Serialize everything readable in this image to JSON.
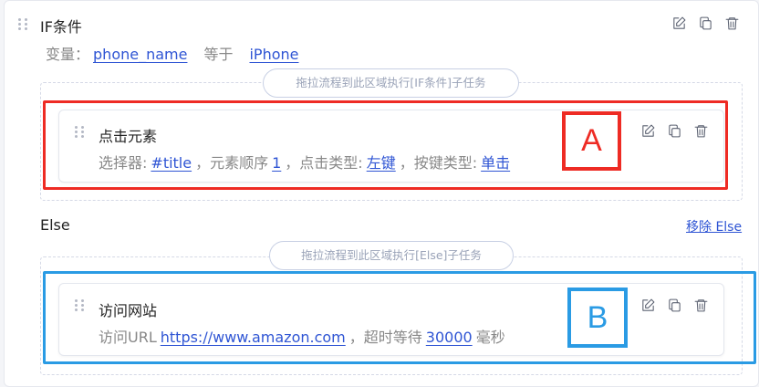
{
  "if_block": {
    "title": "IF条件",
    "condition": {
      "var_label": "变量：",
      "var_value": "phone_name",
      "operator": "等于",
      "compare_value": "iPhone"
    },
    "drop_hint": "拖拉流程到此区域执行[IF条件]子任务",
    "child": {
      "title": "点击元素",
      "selector_label": "选择器:",
      "selector_value": "#title",
      "order_label": "，元素顺序",
      "order_value": "1",
      "click_type_label": "，点击类型:",
      "click_type_value": "左键",
      "key_type_label": "，按键类型:",
      "key_type_value": "单击"
    },
    "marker": "A"
  },
  "else_block": {
    "label": "Else",
    "remove_label": "移除 Else",
    "drop_hint": "拖拉流程到此区域执行[Else]子任务",
    "child": {
      "title": "访问网站",
      "url_label": "访问URL",
      "url_value": "https://www.amazon.com",
      "timeout_label": "，超时等待",
      "timeout_value": "30000",
      "unit": "毫秒"
    },
    "marker": "B"
  },
  "colors": {
    "marker_a": "#ee2b24",
    "marker_b": "#2a9be4",
    "link": "#2f55d4"
  },
  "icons": [
    "drag-handle-icon",
    "edit-icon",
    "copy-icon",
    "delete-icon"
  ]
}
